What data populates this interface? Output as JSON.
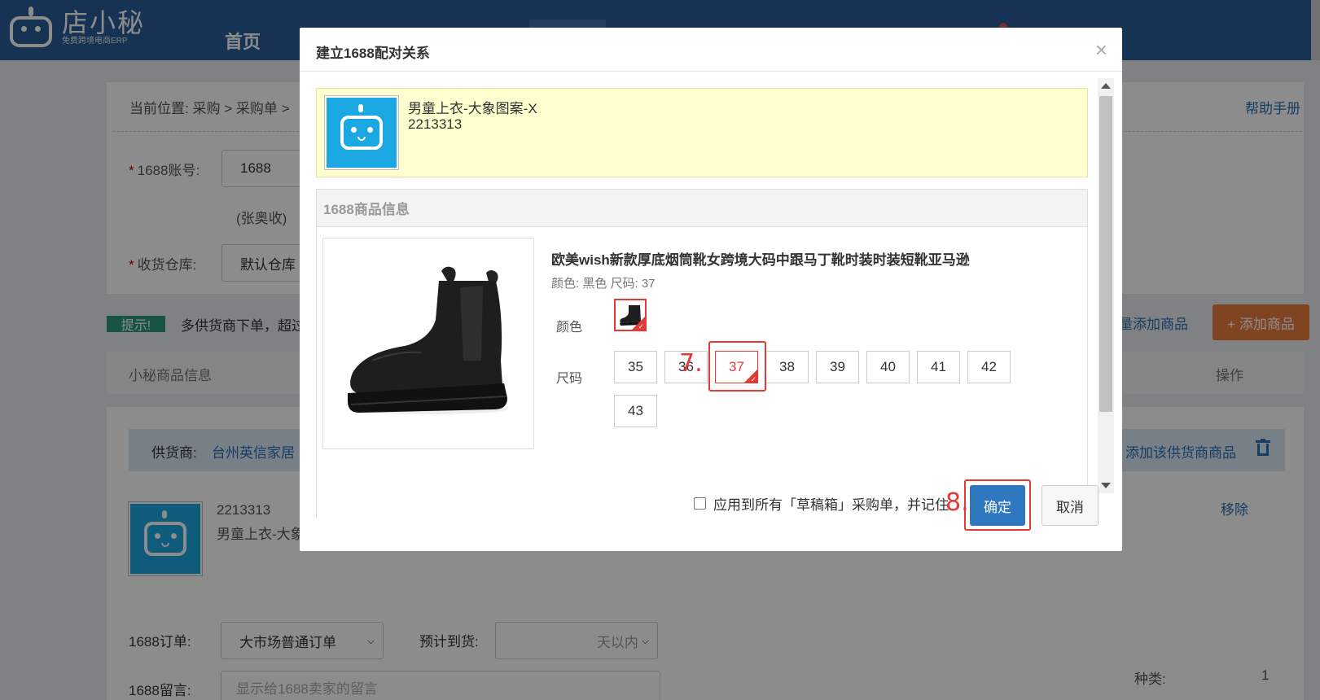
{
  "app": {
    "logo_name": "店小秘",
    "logo_tagline": "免费跨境电商ERP",
    "nav_home": "首页"
  },
  "page": {
    "breadcrumb_prefix": "当前位置:",
    "breadcrumb_1": "采购",
    "breadcrumb_sep": ">",
    "breadcrumb_2": "采购单",
    "breadcrumb_trail": ">",
    "help_link": "帮助手册",
    "account_label": "1688账号:",
    "account_value": "1688",
    "receiver_note": "(张奥收)",
    "warehouse_label": "收货仓库:",
    "warehouse_value": "默认仓库",
    "tip_badge": "提示!",
    "tip_text": "多供货商下单，超过",
    "batch_add": "量添加商品",
    "add_product": "+ 添加商品",
    "col_product_info": "小秘商品信息",
    "col_action": "操作",
    "supplier_label": "供货商:",
    "supplier_name": "台州英信家居",
    "add_supplier_product": "添加该供货商商品",
    "item_code": "2213313",
    "item_name": "男童上衣-大象",
    "remove": "移除",
    "order_label": "1688订单:",
    "order_type": "大市场普通订单",
    "eta_label": "预计到货:",
    "eta_suffix": "天以内",
    "msg_label": "1688留言:",
    "msg_placeholder": "显示给1688卖家的留言",
    "kind_label": "种类:",
    "kind_value": "1"
  },
  "modal": {
    "title": "建立1688配对关系",
    "close": "×",
    "source_name": "男童上衣-大象图案-X",
    "source_code": "2213313",
    "info_header": "1688商品信息",
    "product_title": "欧美wish新款厚底烟筒靴女跨境大码中跟马丁靴时装时装短靴亚马逊",
    "sku_line": "颜色: 黑色 尺码: 37",
    "color_label": "颜色",
    "size_label": "尺码",
    "sizes": [
      "35",
      "36",
      "37",
      "38",
      "39",
      "40",
      "41",
      "42",
      "43"
    ],
    "selected_size": "37",
    "apply_all": "应用到所有「草稿箱」采购单，并记住",
    "ok": "确定",
    "cancel": "取消"
  },
  "annotations": {
    "step7": "7.",
    "step8": "8."
  },
  "colors": {
    "topbar": "#2a5d97",
    "primary": "#2f77be",
    "highlight": "#e53935",
    "orange": "#e87b3f"
  }
}
